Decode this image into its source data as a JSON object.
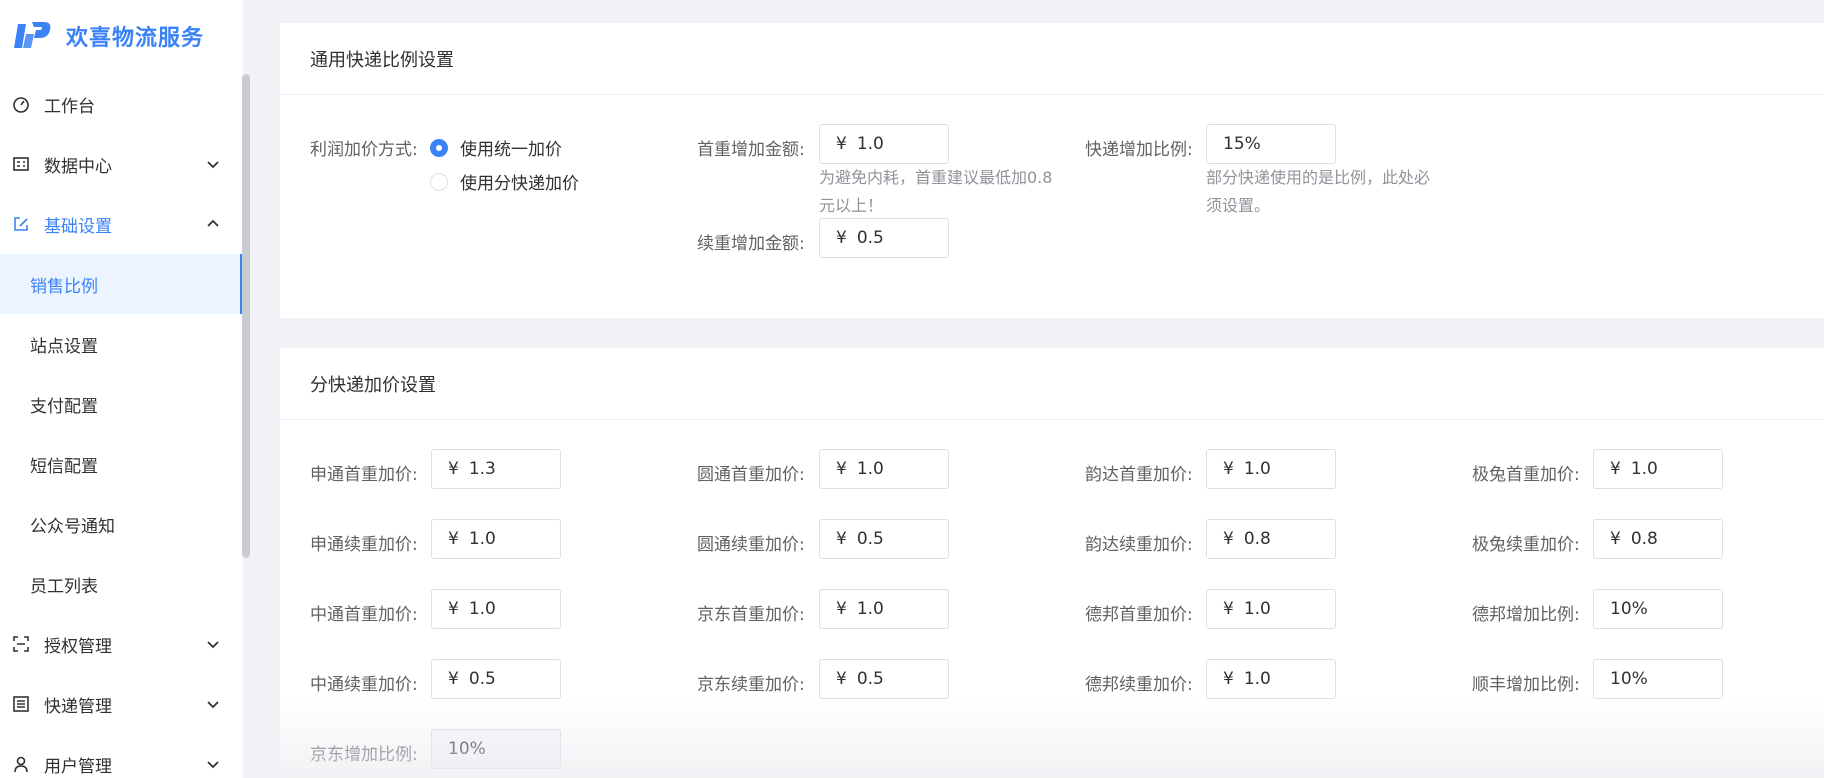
{
  "app": {
    "title": "欢喜物流服务",
    "brand_color": "#3b82f6"
  },
  "sidebar": {
    "workbench": "工作台",
    "data_center": "数据中心",
    "basic_settings": "基础设置",
    "sub": [
      "销售比例",
      "站点设置",
      "支付配置",
      "短信配置",
      "公众号通知",
      "员工列表"
    ],
    "auth": "授权管理",
    "express": "快递管理",
    "user": "用户管理"
  },
  "general": {
    "title": "通用快递比例设置",
    "markup_label": "利润加价方式:",
    "radio_unified": "使用统一加价",
    "radio_per_express": "使用分快递加价",
    "radio_selected": "使用统一加价",
    "first_weight_label": "首重增加金额:",
    "first_weight_value": "1.0",
    "first_weight_hint": "为避免内耗，首重建议最低加0.8元以上！",
    "cont_weight_label": "续重增加金额:",
    "cont_weight_value": "0.5",
    "ratio_label": "快递增加比例:",
    "ratio_value": "15%",
    "ratio_hint": "部分快递使用的是比例，此处必须设置。"
  },
  "per_express": {
    "title": "分快递加价设置",
    "currency": "¥",
    "fields": {
      "sto_first": {
        "label": "申通首重加价:",
        "value": "1.3"
      },
      "yto_first": {
        "label": "圆通首重加价:",
        "value": "1.0"
      },
      "yunda_first": {
        "label": "韵达首重加价:",
        "value": "1.0"
      },
      "jitu_first": {
        "label": "极兔首重加价:",
        "value": "1.0"
      },
      "sto_cont": {
        "label": "申通续重加价:",
        "value": "1.0"
      },
      "yto_cont": {
        "label": "圆通续重加价:",
        "value": "0.5"
      },
      "yunda_cont": {
        "label": "韵达续重加价:",
        "value": "0.8"
      },
      "jitu_cont": {
        "label": "极兔续重加价:",
        "value": "0.8"
      },
      "zto_first": {
        "label": "中通首重加价:",
        "value": "1.0"
      },
      "jd_first": {
        "label": "京东首重加价:",
        "value": "1.0"
      },
      "deppon_first": {
        "label": "德邦首重加价:",
        "value": "1.0"
      },
      "deppon_ratio": {
        "label": "德邦增加比例:",
        "value": "10%"
      },
      "zto_cont": {
        "label": "中通续重加价:",
        "value": "0.5"
      },
      "jd_cont": {
        "label": "京东续重加价:",
        "value": "0.5"
      },
      "deppon_cont": {
        "label": "德邦续重加价:",
        "value": "1.0"
      },
      "sf_ratio": {
        "label": "顺丰增加比例:",
        "value": "10%"
      },
      "jd_ratio": {
        "label": "京东增加比例:",
        "value": "10%"
      }
    }
  }
}
